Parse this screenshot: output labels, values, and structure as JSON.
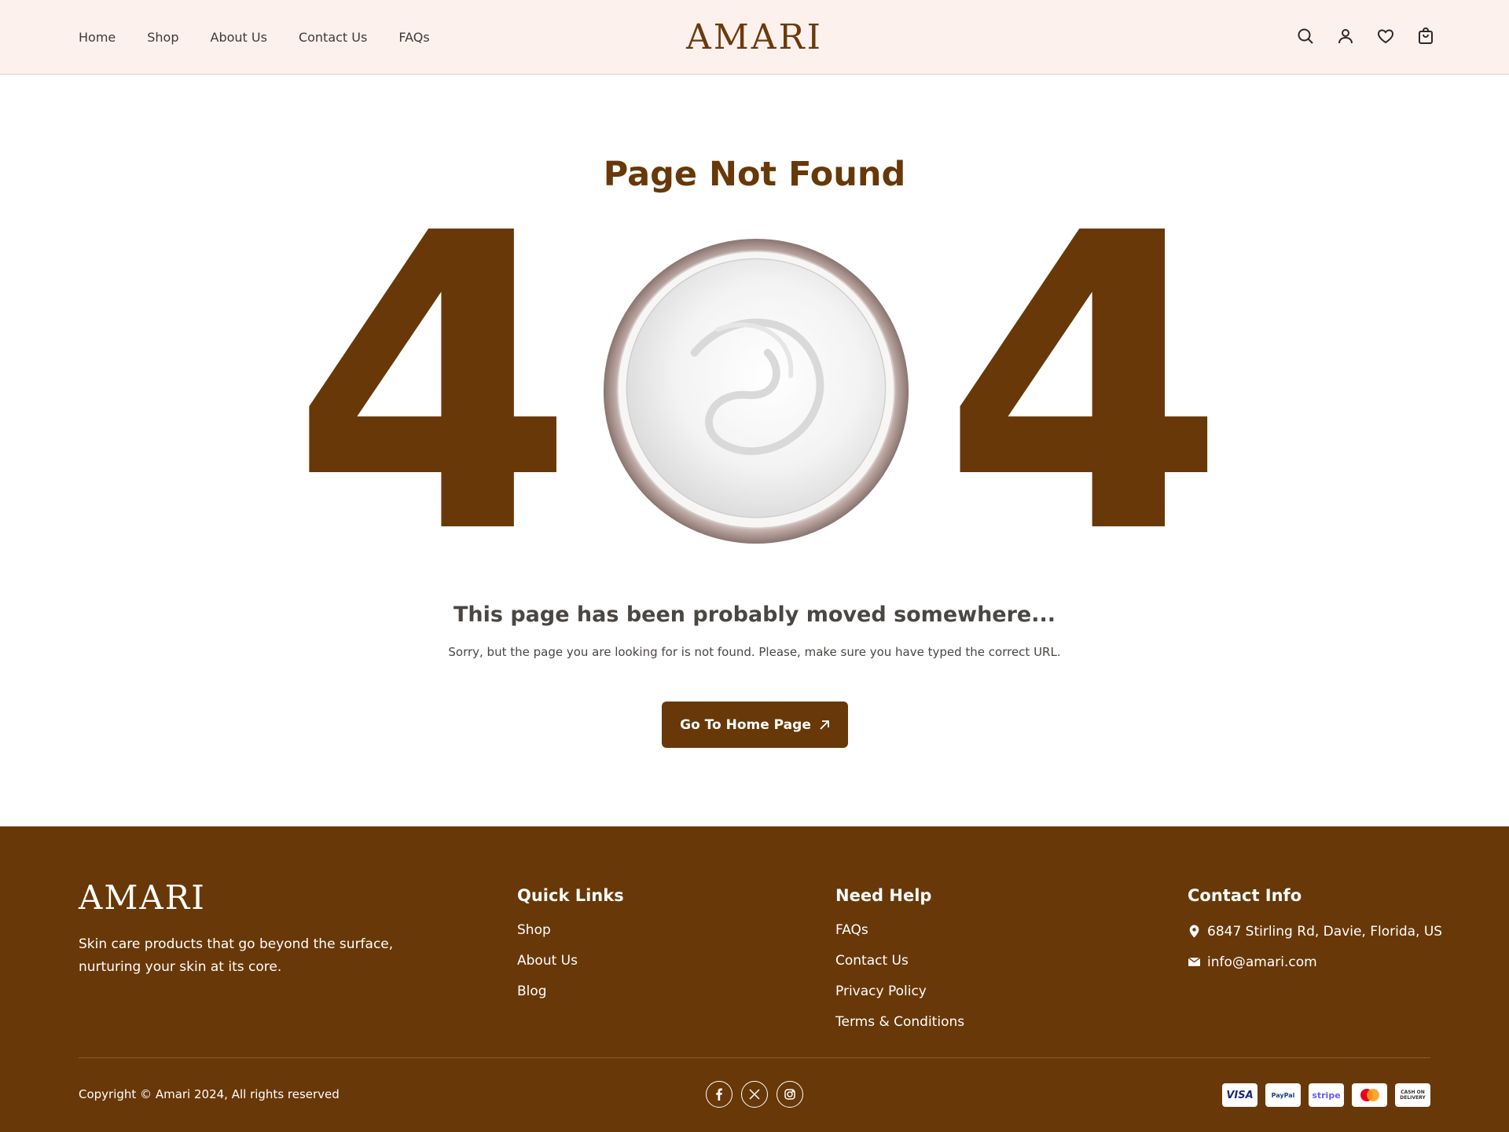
{
  "header": {
    "nav": [
      "Home",
      "Shop",
      "About Us",
      "Contact Us",
      "FAQs"
    ],
    "logo": "AMARI",
    "icons": [
      "search-icon",
      "user-icon",
      "heart-icon",
      "shopping-bag-icon"
    ]
  },
  "main": {
    "title": "Page Not Found",
    "digit_left": "4",
    "digit_right": "4",
    "subtitle": "This page has been probably moved somewhere...",
    "text": "Sorry, but the page you are looking for is not found. Please, make sure you have typed the correct URL.",
    "button_label": "Go To Home Page"
  },
  "footer": {
    "logo": "AMARI",
    "tagline": "Skin care products that go beyond the surface, nurturing your skin at its core.",
    "quick_links": {
      "title": "Quick Links",
      "items": [
        "Shop",
        "About Us",
        "Blog"
      ]
    },
    "need_help": {
      "title": "Need Help",
      "items": [
        "FAQs",
        "Contact Us",
        "Privacy Policy",
        "Terms & Conditions"
      ]
    },
    "contact": {
      "title": "Contact Info",
      "address": "6847 Stirling Rd, Davie, Florida, US",
      "email": "info@amari.com"
    },
    "copyright": "Copyright © Amari 2024, All rights reserved",
    "socials": [
      "facebook-icon",
      "x-icon",
      "instagram-icon"
    ],
    "payments": {
      "visa": "VISA",
      "paypal": "PayPal",
      "stripe": "stripe",
      "mastercard": "mastercard",
      "cod": "CASH ON DELIVERY"
    }
  },
  "colors": {
    "brand_brown": "#683808",
    "header_bg": "#fdf1ee"
  }
}
